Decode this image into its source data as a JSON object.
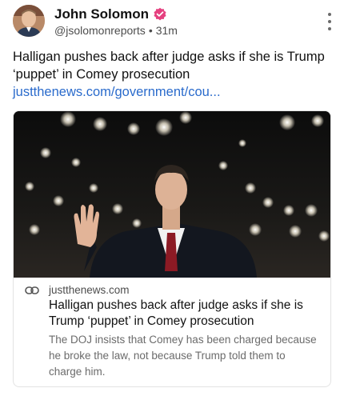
{
  "author": {
    "display_name": "John Solomon",
    "handle": "@jsolomonreports",
    "separator": "•",
    "time": "31m",
    "avatar_icon": "person-avatar",
    "verified_icon": "verified-badge-icon",
    "verified_color": "#e5407f"
  },
  "post": {
    "text": "Halligan pushes back after judge asks if she is Trump ‘puppet’ in Comey prosecution ",
    "link_text": "justthenews.com/government/cou...",
    "link_color": "#2a6bcc"
  },
  "link_card": {
    "image_alt_icon": "photo-man-raising-hand",
    "domain": "justthenews.com",
    "title": "Halligan pushes back after judge asks if she is Trump ‘puppet’ in Comey prosecution",
    "description": "The DOJ insists that Comey has been charged because he broke the law, not because Trump told them to charge him."
  }
}
